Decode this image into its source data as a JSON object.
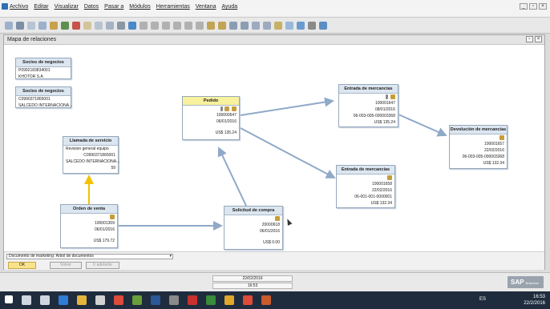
{
  "menubar": {
    "items": [
      "Archivo",
      "Editar",
      "Visualizar",
      "Datos",
      "Pasar a",
      "Módulos",
      "Herramientas",
      "Ventana",
      "Ayuda"
    ]
  },
  "window": {
    "title": "Mapa de relaciones"
  },
  "cards": {
    "socios1": {
      "title": "Socios de negocios",
      "code": "P0992183834001",
      "name": "KHOTOR S.A"
    },
    "socios2": {
      "title": "Socios de negocios",
      "code": "C0990371865001",
      "name": "SALCEDO INTERNACIONA..."
    },
    "llamada": {
      "title": "Llamada de servicio",
      "subject": "Revision general equipo",
      "code": "C0990371865001",
      "name": "SALCEDO INTERNACIONA...",
      "num": "59"
    },
    "pedido": {
      "title": "Pedido",
      "number": "100000547",
      "date": "06/01/2016",
      "total": "US$ 135.24"
    },
    "orden": {
      "title": "Orden de venta",
      "number": "100001309",
      "date": "06/01/2016",
      "total": "US$ 179.72"
    },
    "solicitud": {
      "title": "Solicitud de compra",
      "number": "20000618",
      "date": "06/01/2016",
      "total": "US$ 0.00"
    },
    "entrada1": {
      "title": "Entrada de mercancías",
      "number": "100001647",
      "date": "08/01/2016",
      "ref": "06-003-005-000003368",
      "total": "US$ 135.24"
    },
    "entrada2": {
      "title": "Entrada de mercancías",
      "number": "100001658",
      "date": "22/02/2016",
      "ref": "06-001-001-0000001",
      "total": "US$ 132.34"
    },
    "devolucion": {
      "title": "Devolución de mercancías",
      "number": "100001657",
      "date": "22/02/2016",
      "ref": "06-003-005-000003368",
      "total": "US$ 132.34"
    }
  },
  "bottom": {
    "select_value": "Documento de marketing: Árbol de documentos",
    "ok": "OK",
    "back": "Volver",
    "forward": "Ir adelante"
  },
  "statusbar": {
    "date": "22/02/2016",
    "time": "16:53",
    "logo": "SAP",
    "logo_sub": "Business One"
  },
  "taskbar": {
    "lang": "ES",
    "time": "16:53",
    "date": "22/2/2016"
  },
  "colors": {
    "card_yellow": "#f8f19e",
    "arrow_blue": "#8fa9c8",
    "arrow_yellow": "#f2c200"
  }
}
